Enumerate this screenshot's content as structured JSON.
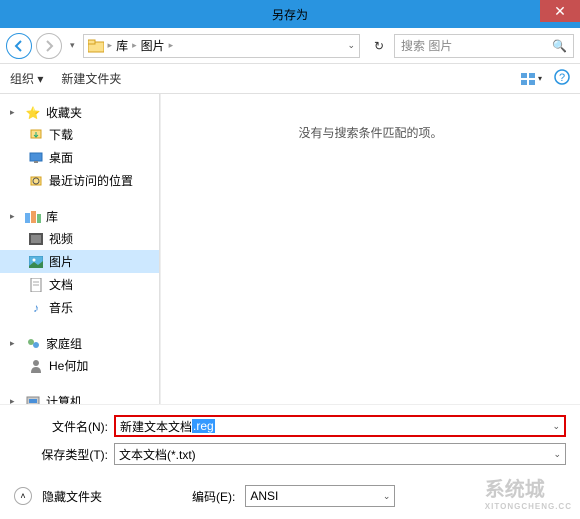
{
  "title": "另存为",
  "nav": {
    "back_chevron": "v",
    "breadcrumb": {
      "root": "库",
      "current": "图片"
    },
    "refresh": "↻",
    "search_placeholder": "搜索 图片"
  },
  "toolbar": {
    "organize": "组织 ▾",
    "new_folder": "新建文件夹"
  },
  "sidebar": {
    "favorites": {
      "label": "收藏夹",
      "items": [
        "下载",
        "桌面",
        "最近访问的位置"
      ]
    },
    "libraries": {
      "label": "库",
      "items": [
        "视频",
        "图片",
        "文档",
        "音乐"
      ]
    },
    "homegroup": {
      "label": "家庭组",
      "items": [
        "He何加"
      ]
    },
    "computer": {
      "label": "计算机"
    }
  },
  "content": {
    "empty_msg": "没有与搜索条件匹配的项。"
  },
  "fields": {
    "filename_label": "文件名(N):",
    "filename_value_prefix": "新建文本文档",
    "filename_value_selected": ".reg",
    "filetype_label": "保存类型(T):",
    "filetype_value": "文本文档(*.txt)"
  },
  "footer": {
    "hide_folders": "隐藏文件夹",
    "encoding_label": "编码(E):",
    "encoding_value": "ANSI"
  },
  "watermark": {
    "main": "系统城",
    "sub": "XITONGCHENG.CC"
  }
}
